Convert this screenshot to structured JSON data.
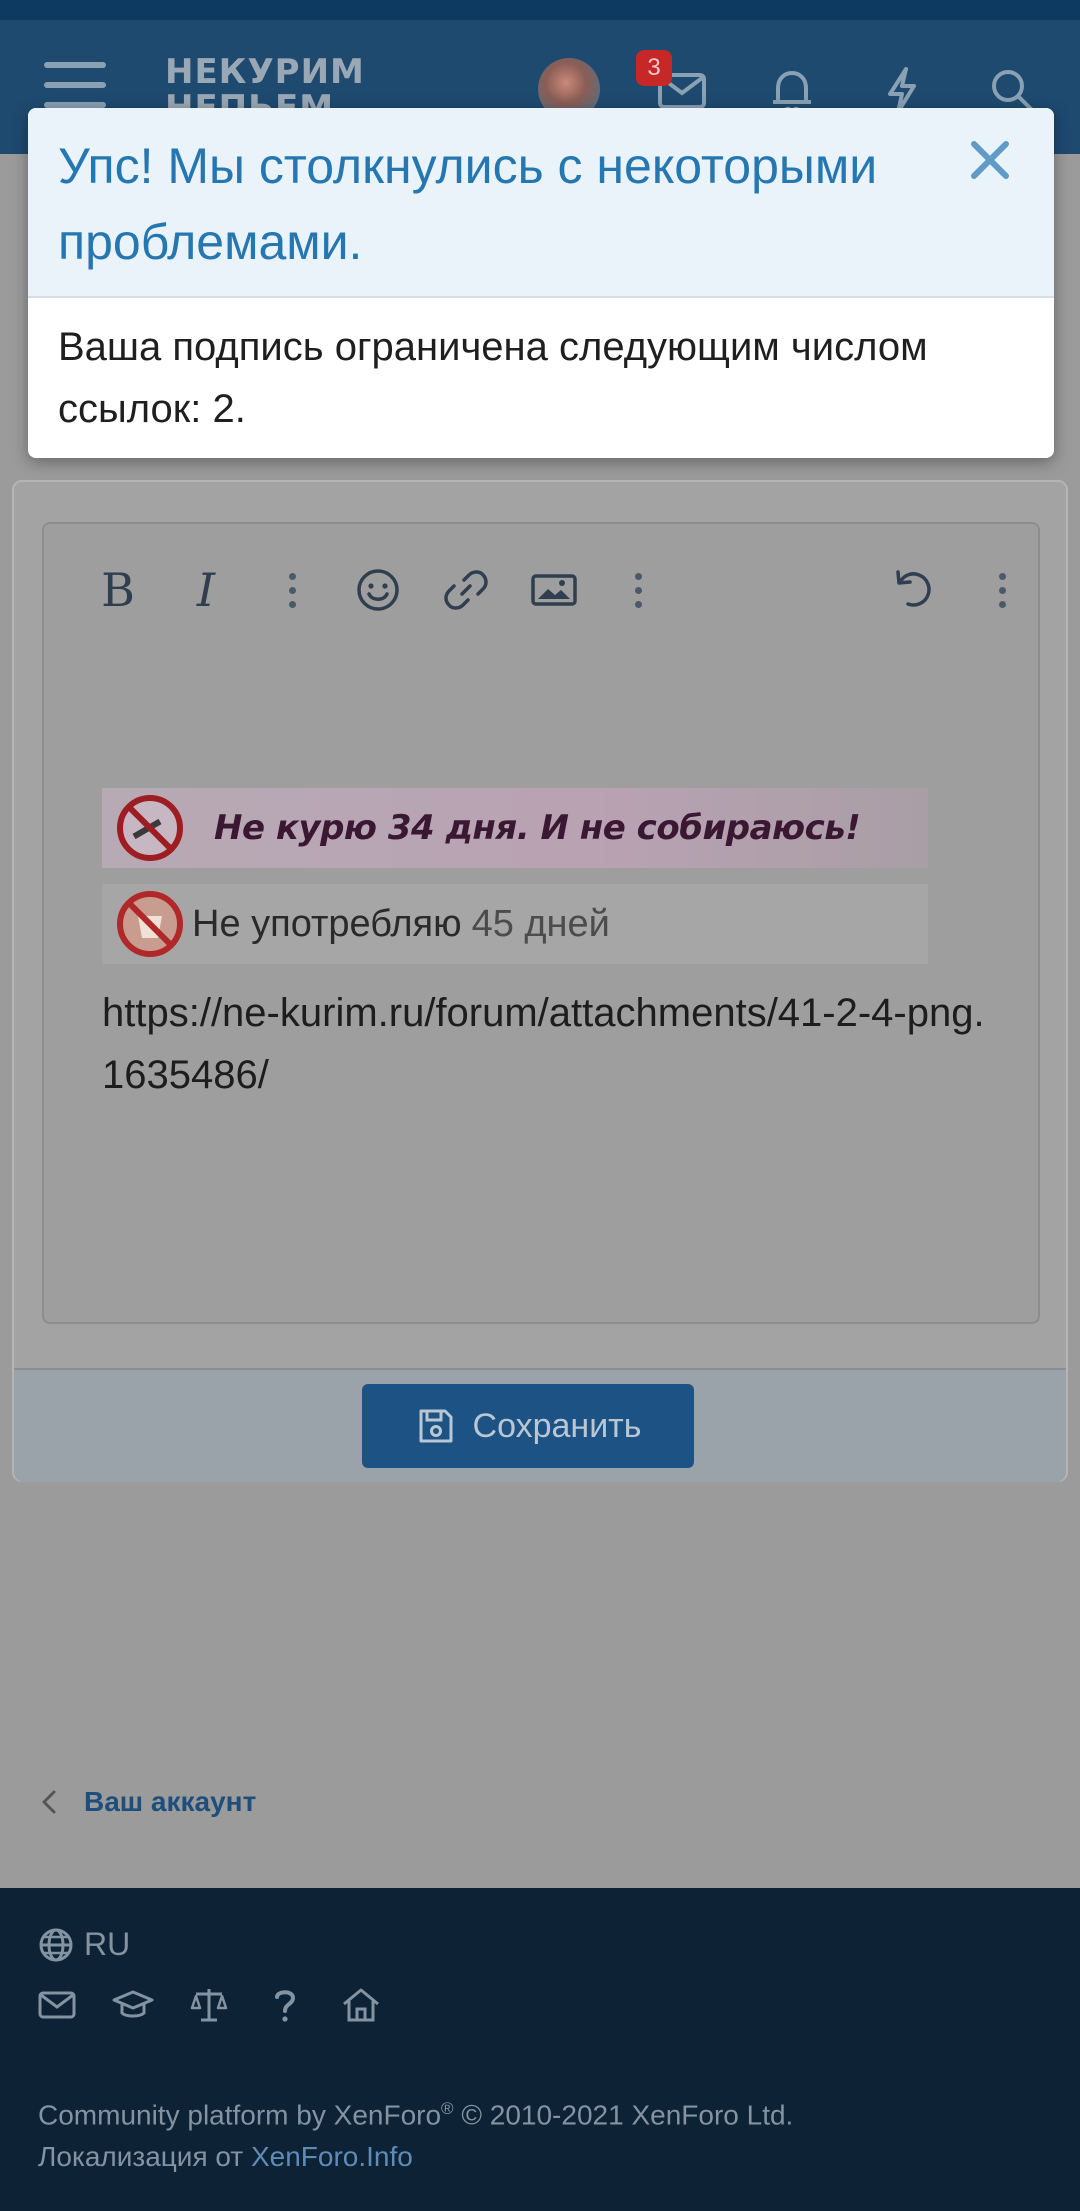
{
  "header": {
    "logo_text": "НЕКУРИМ\nНЕПЬЕМ",
    "inbox_badge": "3",
    "icons": [
      "menu-icon",
      "inbox-icon",
      "bell-icon",
      "bolt-icon",
      "search-icon"
    ]
  },
  "modal": {
    "title": "Упс! Мы столкнулись с некоторыми проблемами.",
    "message": "Ваша подпись ограничена следующим числом ссылок: 2."
  },
  "editor": {
    "toolbar": {
      "bold": "B",
      "italic": "I",
      "items": [
        "bold-icon",
        "italic-icon",
        "more-icon",
        "emoji-icon",
        "link-icon",
        "image-icon",
        "more-icon",
        "undo-icon",
        "more-icon"
      ]
    },
    "signature_banner_1": "Не курю 34 дня. И не собираюсь!",
    "signature_banner_2_main": "Не употребляю",
    "signature_banner_2_days": "45 дней",
    "link_text": "https://ne-kurim.ru/forum/attachments/41-2-4-png.1635486/"
  },
  "form": {
    "save_label": "Сохранить"
  },
  "breadcrumb": {
    "label": "Ваш аккаунт"
  },
  "footer": {
    "language": "RU",
    "icons": [
      "mail-icon",
      "graduation-cap-icon",
      "scales-icon",
      "help-icon",
      "home-icon"
    ],
    "copyright_prefix": "Community platform by XenForo",
    "copyright_mark": "®",
    "copyright_suffix": " © 2010-2021 XenForo Ltd.",
    "localization_prefix": "Локализация от ",
    "localization_link": "XenForo.Info"
  },
  "colors": {
    "header_bg": "#1e4a70",
    "accent": "#2577b1",
    "save_button": "#1c5384",
    "footer_bg": "#0e2235",
    "badge": "#c62828"
  }
}
